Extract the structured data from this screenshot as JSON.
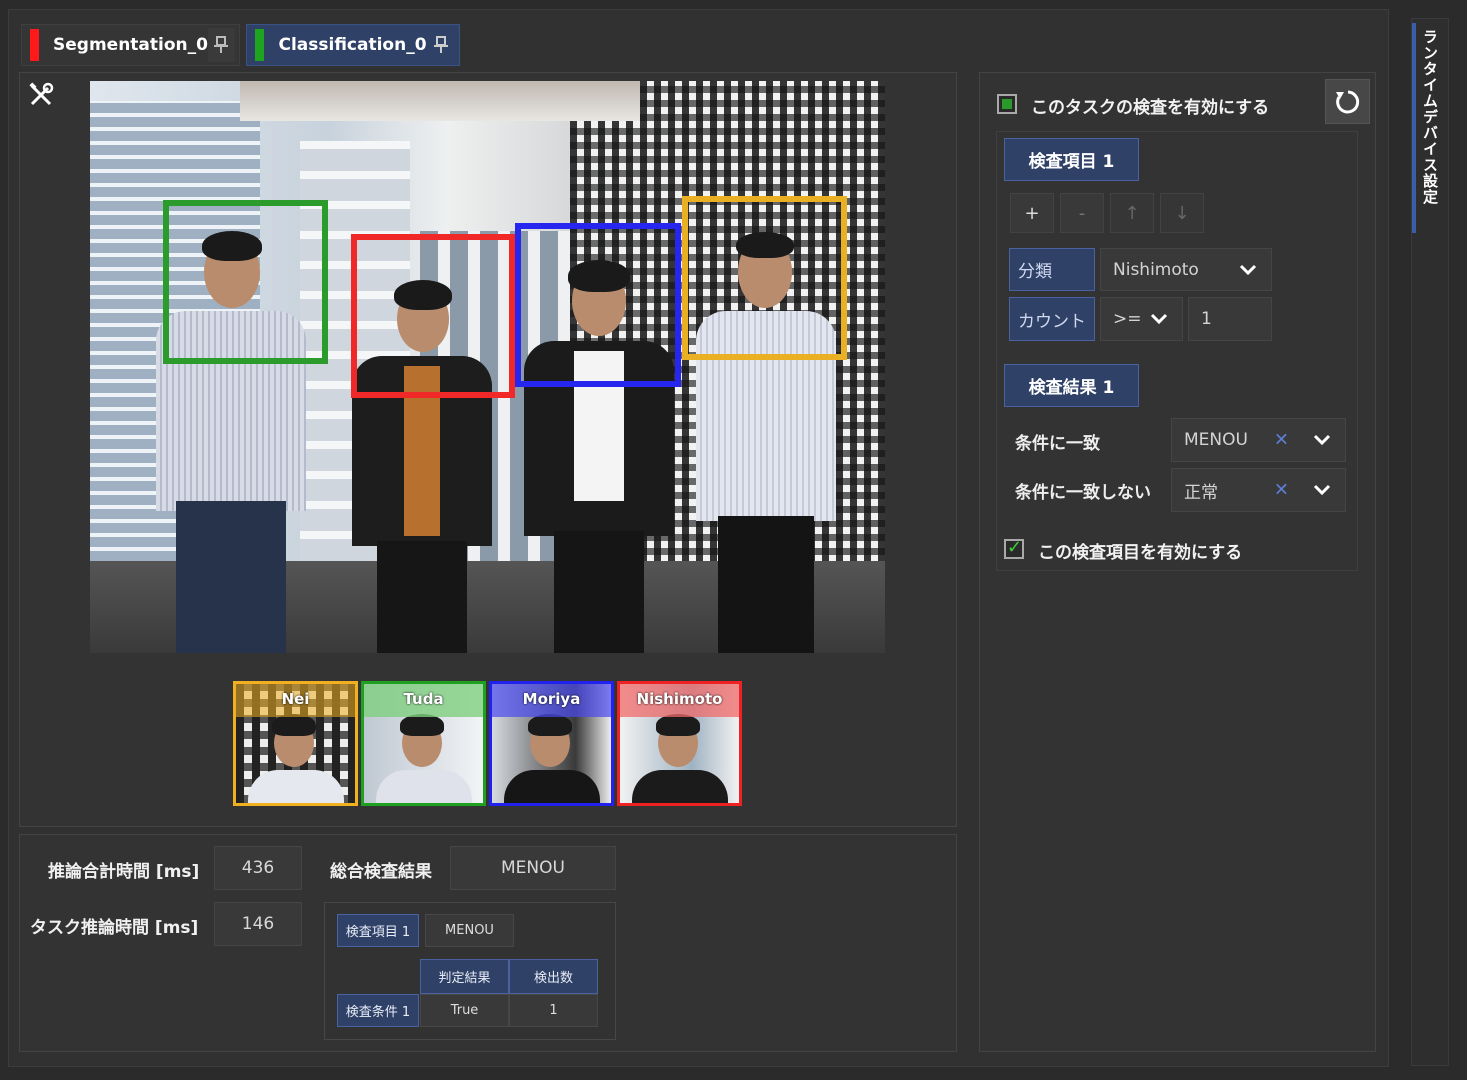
{
  "tabs": [
    {
      "label": "Segmentation_0",
      "color": "#ff1a1a"
    },
    {
      "label": "Classification_0",
      "color": "#1ea41e"
    }
  ],
  "icons": {
    "tools": "tools-icon",
    "pin": "pin-icon",
    "reset": "reset-icon",
    "chevron": "chevron-down-icon",
    "clear": "clear-icon"
  },
  "thumbnails": [
    {
      "label": "Nei",
      "color": "#f0b020",
      "shirt": "#e6e8f0"
    },
    {
      "label": "Tuda",
      "color": "#20a020",
      "shirt": "#dfe2ea"
    },
    {
      "label": "Moriya",
      "color": "#2222ee",
      "shirt": "#161616"
    },
    {
      "label": "Nishimoto",
      "color": "#ee2222",
      "shirt": "#1b1b1b"
    }
  ],
  "results": {
    "total_time_label": "推論合計時間 [ms]",
    "total_time_value": "436",
    "task_time_label": "タスク推論時間 [ms]",
    "task_time_value": "146",
    "overall_label": "総合検査結果",
    "overall_value": "MENOU",
    "item_label": "検査項目 1",
    "item_value": "MENOU",
    "col_judgement": "判定結果",
    "col_count": "検出数",
    "condition_label": "検査条件 1",
    "condition_result": "True",
    "condition_count": "1"
  },
  "settings": {
    "enable_task_label": "このタスクの検査を有効にする",
    "item_header": "検査項目 1",
    "plus": "+",
    "minus": "-",
    "up": "↑",
    "down": "↓",
    "class_label": "分類",
    "class_value": "Nishimoto",
    "count_label": "カウント",
    "count_operator": ">=",
    "count_value": "1",
    "result_header": "検査結果 1",
    "match_label": "条件に一致",
    "match_value": "MENOU",
    "nomatch_label": "条件に一致しない",
    "nomatch_value": "正常",
    "enable_item_label": "この検査項目を有効にする"
  },
  "side_tab": {
    "label": "ランタイムデバイス設定"
  }
}
